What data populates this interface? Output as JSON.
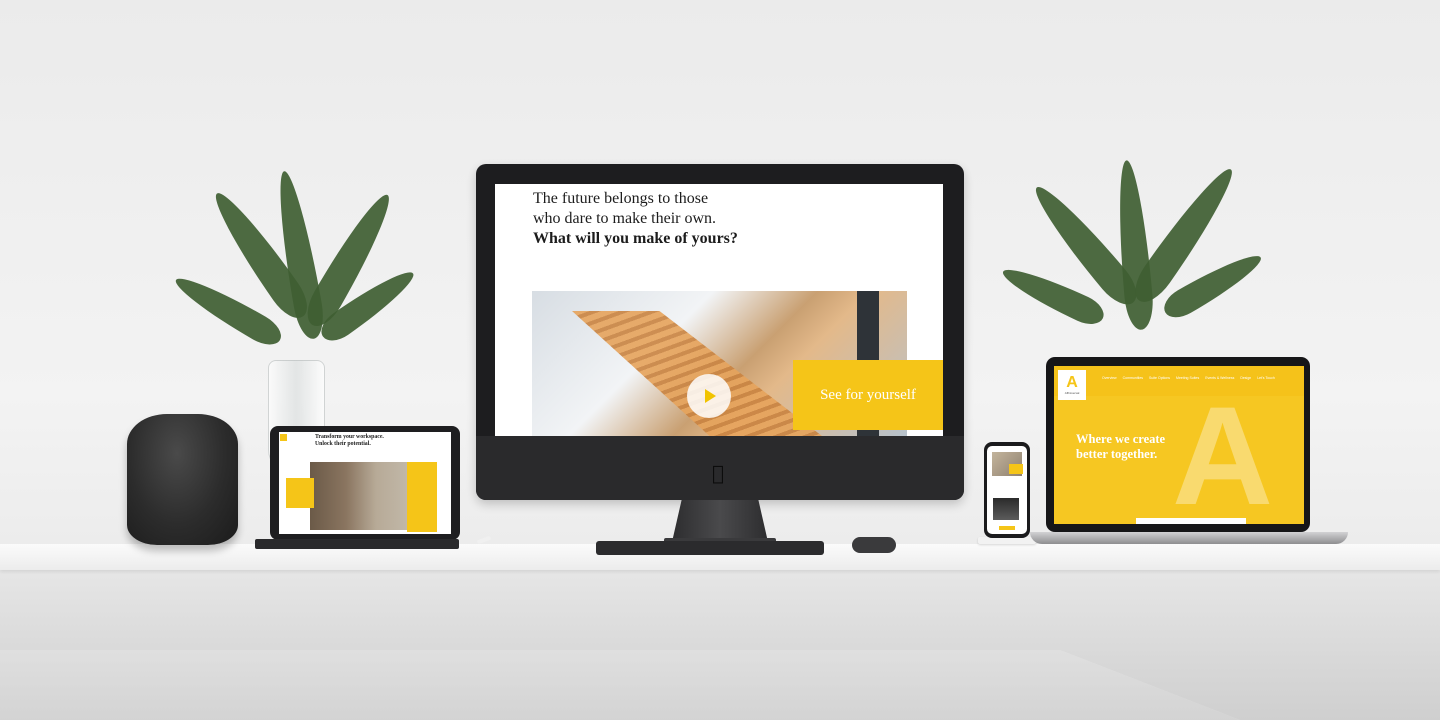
{
  "imac": {
    "hero_line1": "The future belongs to those",
    "hero_line2": "who dare to make their own.",
    "hero_line3": "What will you make of yours?",
    "cta_label": "See for yourself",
    "play_icon": "play-icon"
  },
  "ipad": {
    "title_line1": "Transform your workspace.",
    "title_line2": "Unlock their potential."
  },
  "macbook": {
    "logo_letter": "A",
    "logo_name": "Affiniversal",
    "nav": [
      "Overview",
      "Communities",
      "Suite Options",
      "Meeting Suites",
      "Events & Wellness",
      "Design",
      "Let's Touch"
    ],
    "hero_line1": "Where we create",
    "hero_line2": "better together."
  },
  "colors": {
    "accent": "#f5c518",
    "device_dark": "#1d1d1f",
    "background": "#ebebeb"
  }
}
